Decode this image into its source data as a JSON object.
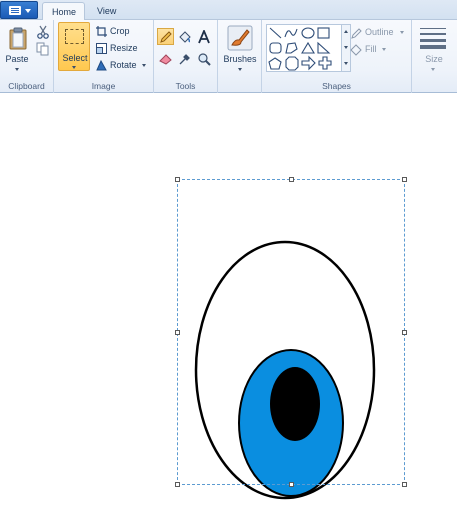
{
  "tabs": {
    "home": "Home",
    "view": "View"
  },
  "clipboard": {
    "paste": "Paste",
    "label": "Clipboard"
  },
  "image": {
    "select": "Select",
    "crop": "Crop",
    "resize": "Resize",
    "rotate": "Rotate",
    "label": "Image"
  },
  "tools": {
    "label": "Tools"
  },
  "brushes": {
    "label": "Brushes"
  },
  "shapes": {
    "outline": "Outline",
    "fill": "Fill",
    "label": "Shapes"
  },
  "size": {
    "label": "Size"
  },
  "colors": {
    "accent": "#1b5bb5",
    "selected": "#ffc84f",
    "iris": "#0a8ee0",
    "pupil": "#000000",
    "selection_border": "#5c9bd1"
  },
  "icons": [
    "app-menu-icon",
    "paste-icon",
    "cut-icon",
    "copy-icon",
    "select-icon",
    "crop-icon",
    "resize-icon",
    "rotate-icon",
    "pencil-icon",
    "fill-icon",
    "text-icon",
    "eraser-icon",
    "color-picker-icon",
    "magnifier-icon",
    "brushes-icon",
    "outline-icon",
    "fill-shape-icon",
    "size-icon"
  ]
}
